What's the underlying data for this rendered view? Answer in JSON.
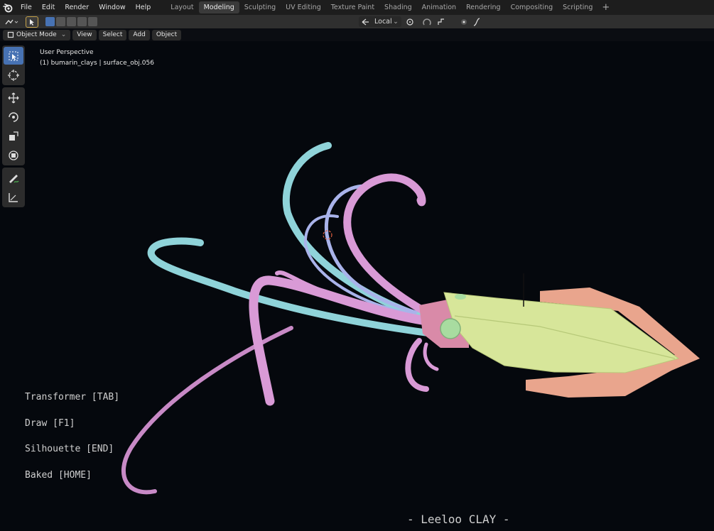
{
  "menu": {
    "items": [
      "File",
      "Edit",
      "Render",
      "Window",
      "Help"
    ]
  },
  "workspaces": {
    "tabs": [
      "Layout",
      "Modeling",
      "Sculpting",
      "UV Editing",
      "Texture Paint",
      "Shading",
      "Animation",
      "Rendering",
      "Compositing",
      "Scripting"
    ],
    "active": "Modeling"
  },
  "header": {
    "orientation_value": "Local"
  },
  "viewport_header": {
    "mode": "Object Mode",
    "view": "View",
    "select": "Select",
    "add": "Add",
    "object": "Object"
  },
  "viewport": {
    "perspective": "User Perspective",
    "object_info": "(1) bumarin_clays | surface_obj.056"
  },
  "overlay": {
    "line1": "Transformer [TAB]",
    "line2": "Draw [F1]",
    "line3": "Silhouette [END]",
    "line4": "Baked [HOME]"
  },
  "watermark": "- Leeloo CLAY -",
  "colors": {
    "active_blue": "#4772b3",
    "tentacle_cyan": "#8fd3d9",
    "tentacle_pink": "#d99ad6",
    "tentacle_lavender": "#a9b3ea",
    "body_yellow": "#d7e69a",
    "fin_salmon": "#e9a58d",
    "eye_green": "#a8dca0"
  }
}
